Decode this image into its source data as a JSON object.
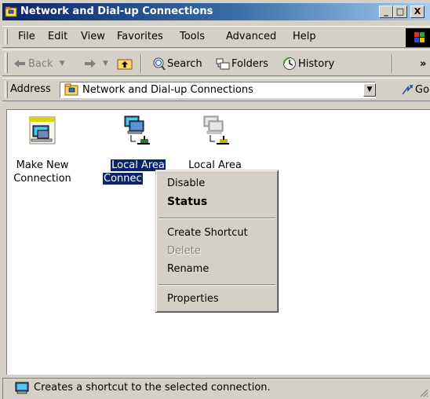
{
  "window": {
    "title": "Network and Dial-up Connections",
    "caption_buttons": [
      "_",
      "□",
      "X"
    ]
  },
  "menubar": {
    "items": [
      "File",
      "Edit",
      "View",
      "Favorites",
      "Tools",
      "Advanced",
      "Help"
    ]
  },
  "toolbar": {
    "back_label": "Back",
    "search_label": "Search",
    "folders_label": "Folders",
    "history_label": "History",
    "more_glyph": "»"
  },
  "address": {
    "label": "Address",
    "value": "Network and Dial-up Connections",
    "go_label": "Go"
  },
  "content": {
    "items": [
      {
        "line1": "Make New",
        "line2": "Connection",
        "icon": "make-new-connection-icon"
      },
      {
        "line1": "Local Area",
        "line2": "Connec",
        "icon": "network-connection-icon",
        "selected": true
      },
      {
        "line1": "Local Area",
        "line2": "",
        "icon": "network-connection-disabled-icon"
      }
    ]
  },
  "context_menu": {
    "disable": "Disable",
    "status": "Status",
    "create_shortcut": "Create Shortcut",
    "delete": "Delete",
    "rename": "Rename",
    "properties": "Properties"
  },
  "statusbar": {
    "text": "Creates a shortcut to the selected connection."
  },
  "colors": {
    "title_active": "#0a246a",
    "face": "#d4d0c8",
    "selection": "#0a246a"
  }
}
